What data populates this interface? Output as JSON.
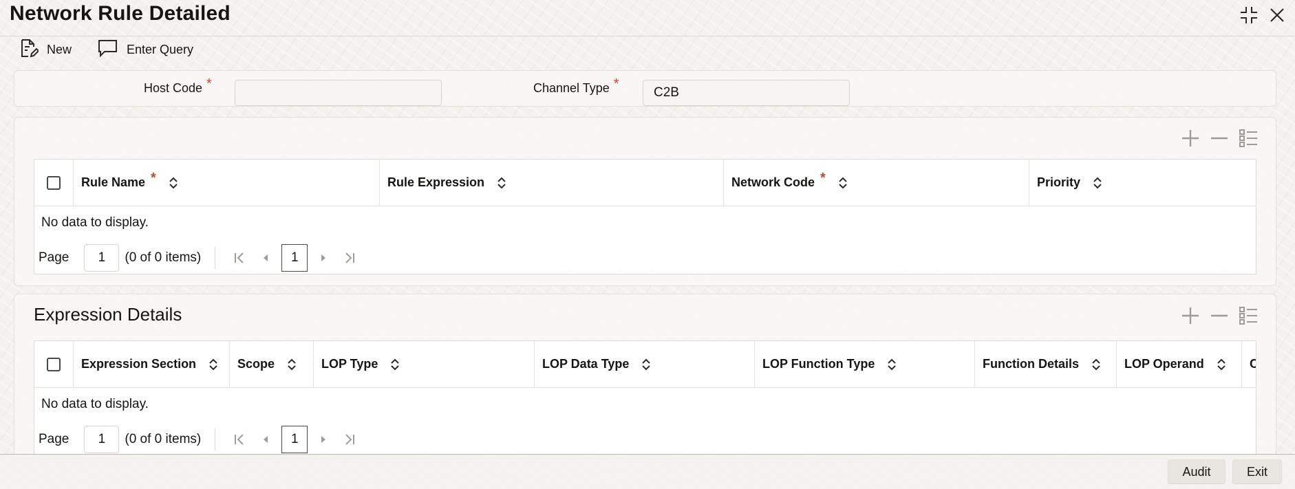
{
  "window": {
    "title": "Network Rule Detailed",
    "restore_icon": "restore-icon",
    "close_icon": "close-icon"
  },
  "toolbar": {
    "new_label": "New",
    "enter_query_label": "Enter Query"
  },
  "header_fields": {
    "host_code": {
      "label": "Host Code",
      "value": "",
      "required_mark": "*"
    },
    "channel_type": {
      "label": "Channel Type",
      "value": "C2B",
      "required_mark": "*"
    }
  },
  "rules_grid": {
    "columns": [
      {
        "label": "Rule Name",
        "required_mark": "*"
      },
      {
        "label": "Rule Expression",
        "required_mark": ""
      },
      {
        "label": "Network Code",
        "required_mark": "*"
      },
      {
        "label": "Priority",
        "required_mark": ""
      }
    ],
    "empty_text": "No data to display.",
    "pager": {
      "page_label": "Page",
      "page_value": "1",
      "items_text": "(0 of 0 items)",
      "current_page": "1"
    }
  },
  "expression_details": {
    "title": "Expression Details",
    "columns": [
      {
        "label": "Expression Section"
      },
      {
        "label": "Scope"
      },
      {
        "label": "LOP Type"
      },
      {
        "label": "LOP Data Type"
      },
      {
        "label": "LOP Function Type"
      },
      {
        "label": "Function Details"
      },
      {
        "label": "LOP Operand"
      },
      {
        "label": "C"
      }
    ],
    "empty_text": "No data to display.",
    "pager": {
      "page_label": "Page",
      "page_value": "1",
      "items_text": "(0 of 0 items)",
      "current_page": "1"
    }
  },
  "footer": {
    "audit_label": "Audit",
    "exit_label": "Exit"
  },
  "colors": {
    "required": "#c74634",
    "text": "#161513",
    "icon": "#4a4744",
    "icon_muted": "#9e9a95"
  }
}
